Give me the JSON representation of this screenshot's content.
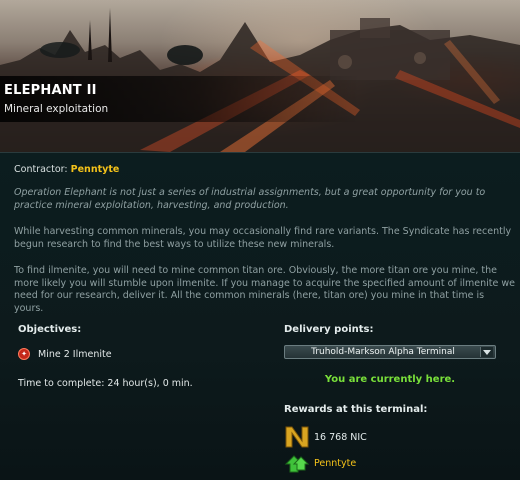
{
  "header": {
    "title": "ELEPHANT II",
    "subtitle": "Mineral exploitation"
  },
  "contractor": {
    "label": "Contractor:",
    "name": "Penntyte"
  },
  "description": [
    "Operation Elephant is not just a series of industrial assignments, but a great opportunity for you to practice mineral exploitation, harvesting, and production.",
    "While harvesting common minerals, you may occasionally find rare variants. The Syndicate has recently begun research to find the best ways to utilize these new minerals.",
    "To find ilmenite, you will need to mine common titan ore. Obviously, the more titan ore you mine, the more likely you will stumble upon ilmenite. If you manage to acquire the specified amount of ilmenite we need for our research, deliver it. All the common minerals (here, titan ore) you mine in that time is yours."
  ],
  "objectives": {
    "heading": "Objectives:",
    "items": [
      {
        "icon": "red-objective-icon",
        "label": "Mine 2 Ilmenite"
      }
    ],
    "time_label": "Time to complete: 24 hour(s), 0 min."
  },
  "delivery": {
    "heading": "Delivery points:",
    "selected": "Truhold-Markson Alpha Terminal",
    "status": "You are currently here."
  },
  "rewards": {
    "heading": "Rewards at this terminal:",
    "items": [
      {
        "icon": "nic-currency-icon",
        "value": "16 768 NIC"
      },
      {
        "icon": "reputation-up-icon",
        "value": "Penntyte"
      }
    ]
  },
  "colors": {
    "accent_yellow": "#f4c21a",
    "here_green": "#79e03a",
    "objective_red": "#c4281a"
  }
}
